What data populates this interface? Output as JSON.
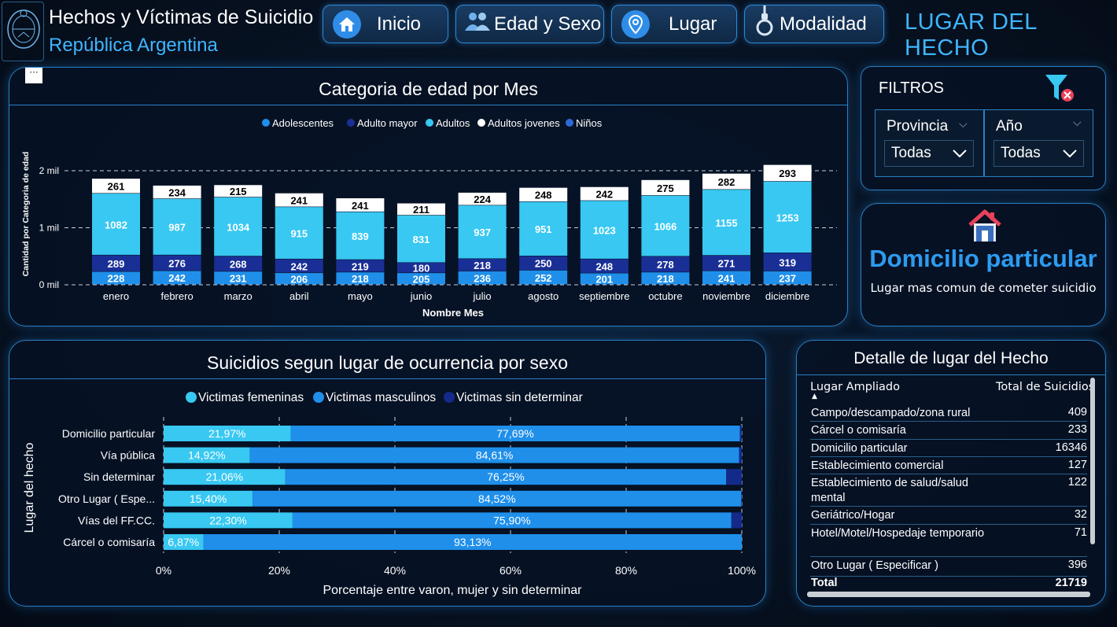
{
  "header": {
    "title": "Hechos y Víctimas de Suicidio",
    "subtitle": "República Argentina",
    "page_heading": "LUGAR DEL HECHO",
    "nav": [
      {
        "label": "Inicio",
        "icon": "home-icon"
      },
      {
        "label": "Edad y Sexo",
        "icon": "users-icon"
      },
      {
        "label": "Lugar",
        "icon": "location-pin-icon"
      },
      {
        "label": "Modalidad",
        "icon": "noose-icon"
      }
    ]
  },
  "filters": {
    "title": "FILTROS",
    "provincia": {
      "label": "Provincia",
      "value": "Todas"
    },
    "anio": {
      "label": "Año",
      "value": "Todas"
    }
  },
  "highlight": {
    "value": "Domicilio particular",
    "caption": "Lugar mas comun de cometer suicidio",
    "icon": "house-icon"
  },
  "colors": {
    "adolescentes": "#1f8fea",
    "adulto_mayor": "#1a2f96",
    "adultos": "#38c8f2",
    "adultos_jovenes": "#ffffff",
    "ninos": "#2c6ad8",
    "femeninas": "#38c8f2",
    "masculinos": "#1f8fea",
    "sin_determinar": "#142a8a"
  },
  "chart_data": [
    {
      "type": "bar",
      "stacked": true,
      "title": "Categoria de edad por Mes",
      "xlabel": "Nombre Mes",
      "ylabel": "Cantidad por Categoria de edad",
      "yticks": [
        "0 mil",
        "1 mil",
        "2 mil"
      ],
      "ylim": [
        0,
        2000
      ],
      "grid": true,
      "legend_position": "top",
      "categories": [
        "enero",
        "febrero",
        "marzo",
        "abril",
        "mayo",
        "junio",
        "julio",
        "agosto",
        "septiembre",
        "octubre",
        "noviembre",
        "diciembre"
      ],
      "series": [
        {
          "name": "Adolescentes",
          "values": [
            228,
            242,
            231,
            206,
            218,
            205,
            236,
            252,
            201,
            218,
            241,
            237
          ]
        },
        {
          "name": "Adulto mayor",
          "values": [
            289,
            276,
            268,
            242,
            219,
            180,
            218,
            250,
            248,
            278,
            271,
            319
          ]
        },
        {
          "name": "Adultos",
          "values": [
            1082,
            987,
            1034,
            915,
            839,
            831,
            937,
            951,
            1023,
            1066,
            1155,
            1253
          ]
        },
        {
          "name": "Adultos jovenes",
          "values": [
            261,
            234,
            215,
            241,
            241,
            211,
            224,
            248,
            242,
            275,
            282,
            293
          ]
        },
        {
          "name": "Niños",
          "values": [
            0,
            0,
            0,
            0,
            0,
            0,
            0,
            0,
            0,
            0,
            0,
            0
          ]
        }
      ]
    },
    {
      "type": "bar",
      "orientation": "horizontal",
      "stacked": true,
      "title": "Suicidios segun lugar de ocurrencia por sexo",
      "xlabel": "Porcentaje entre varon, mujer y sin determinar",
      "ylabel": "Lugar del hecho",
      "xticks": [
        "0%",
        "20%",
        "40%",
        "60%",
        "80%",
        "100%"
      ],
      "xlim": [
        0,
        100
      ],
      "legend_position": "top",
      "categories": [
        "Domicilio particular",
        "Vía pública",
        "Sin determinar",
        "Otro Lugar ( Espe...",
        "Vías del FF.CC.",
        "Cárcel o comisaría"
      ],
      "series": [
        {
          "name": "Victimas femeninas",
          "values": [
            21.97,
            14.92,
            21.06,
            15.4,
            22.3,
            6.87
          ],
          "labels": [
            "21,97%",
            "14,92%",
            "21,06%",
            "15,40%",
            "22,30%",
            "6,87%"
          ]
        },
        {
          "name": "Victimas masculinos",
          "values": [
            77.69,
            84.61,
            76.25,
            84.52,
            75.9,
            93.13
          ],
          "labels": [
            "77,69%",
            "84,61%",
            "76,25%",
            "84,52%",
            "75,90%",
            "93,13%"
          ]
        },
        {
          "name": "Victimas sin determinar",
          "values": [
            0.34,
            0.47,
            2.69,
            0.08,
            1.8,
            0.0
          ]
        }
      ]
    }
  ],
  "table": {
    "title": "Detalle de lugar del Hecho",
    "col1": "Lugar Ampliado",
    "col2": "Total de Suicidios",
    "rows": [
      {
        "lugar": "Campo/descampado/zona rural",
        "total": "409"
      },
      {
        "lugar": "Cárcel o comisaría",
        "total": "233"
      },
      {
        "lugar": "Domicilio particular",
        "total": "16346"
      },
      {
        "lugar": "Establecimiento comercial",
        "total": "127"
      },
      {
        "lugar": "Establecimiento de salud/salud mental",
        "total": "122"
      },
      {
        "lugar": "Geriátrico/Hogar",
        "total": "32"
      },
      {
        "lugar": "Hotel/Motel/Hospedaje temporario",
        "total": "71"
      },
      {
        "lugar": "Otro Lugar ( Especificar )",
        "total": "396"
      }
    ],
    "total_label": "Total",
    "total_value": "21719"
  }
}
